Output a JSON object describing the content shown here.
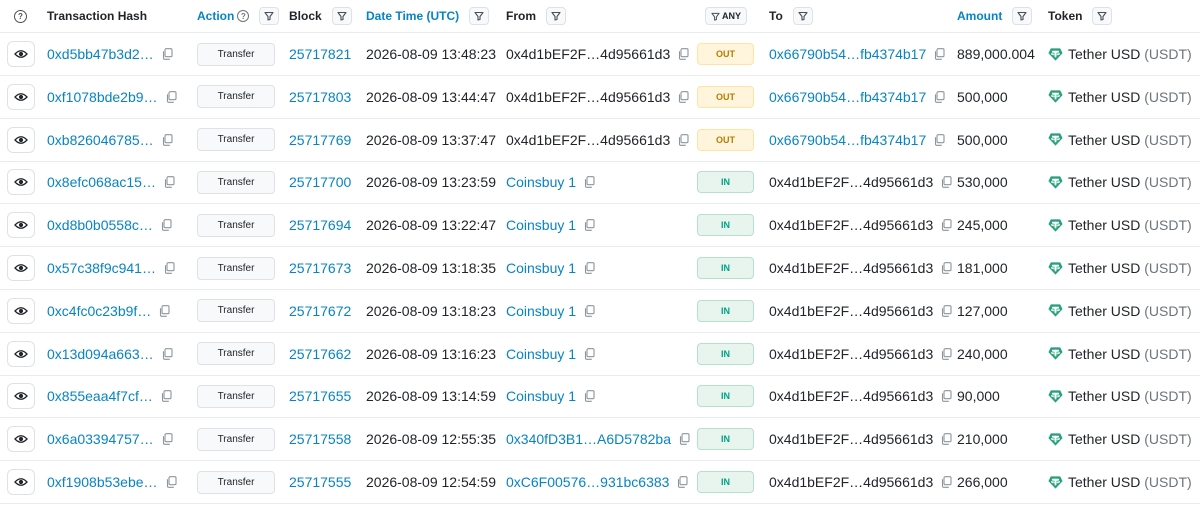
{
  "columns": {
    "help_icon": "question-circle-icon",
    "tx_hash": "Transaction Hash",
    "action": "Action",
    "block": "Block",
    "datetime": "Date Time (UTC)",
    "from": "From",
    "direction_filter": "ANY",
    "to": "To",
    "amount": "Amount",
    "token": "Token"
  },
  "colors": {
    "link": "#0784c3",
    "out_badge": "#b47d00",
    "in_badge": "#00a186",
    "tether": "#26a17b"
  },
  "rows": [
    {
      "hash": "0xd5bb47b3d2…",
      "action": "Transfer",
      "block": "25717821",
      "time": "2026-08-09 13:48:23",
      "from": "0x4d1bEF2F…4d95661d3",
      "from_link": false,
      "dir": "OUT",
      "to": "0x66790b54…fb4374b17",
      "to_link": true,
      "amount": "889,000.004",
      "token": "Tether USD",
      "symbol": "(USDT)"
    },
    {
      "hash": "0xf1078bde2b9…",
      "action": "Transfer",
      "block": "25717803",
      "time": "2026-08-09 13:44:47",
      "from": "0x4d1bEF2F…4d95661d3",
      "from_link": false,
      "dir": "OUT",
      "to": "0x66790b54…fb4374b17",
      "to_link": true,
      "amount": "500,000",
      "token": "Tether USD",
      "symbol": "(USDT)"
    },
    {
      "hash": "0xb826046785…",
      "action": "Transfer",
      "block": "25717769",
      "time": "2026-08-09 13:37:47",
      "from": "0x4d1bEF2F…4d95661d3",
      "from_link": false,
      "dir": "OUT",
      "to": "0x66790b54…fb4374b17",
      "to_link": true,
      "amount": "500,000",
      "token": "Tether USD",
      "symbol": "(USDT)"
    },
    {
      "hash": "0x8efc068ac15…",
      "action": "Transfer",
      "block": "25717700",
      "time": "2026-08-09 13:23:59",
      "from": "Coinsbuy 1",
      "from_link": true,
      "dir": "IN",
      "to": "0x4d1bEF2F…4d95661d3",
      "to_link": false,
      "amount": "530,000",
      "token": "Tether USD",
      "symbol": "(USDT)"
    },
    {
      "hash": "0xd8b0b0558c…",
      "action": "Transfer",
      "block": "25717694",
      "time": "2026-08-09 13:22:47",
      "from": "Coinsbuy 1",
      "from_link": true,
      "dir": "IN",
      "to": "0x4d1bEF2F…4d95661d3",
      "to_link": false,
      "amount": "245,000",
      "token": "Tether USD",
      "symbol": "(USDT)"
    },
    {
      "hash": "0x57c38f9c941…",
      "action": "Transfer",
      "block": "25717673",
      "time": "2026-08-09 13:18:35",
      "from": "Coinsbuy 1",
      "from_link": true,
      "dir": "IN",
      "to": "0x4d1bEF2F…4d95661d3",
      "to_link": false,
      "amount": "181,000",
      "token": "Tether USD",
      "symbol": "(USDT)"
    },
    {
      "hash": "0xc4fc0c23b9f…",
      "action": "Transfer",
      "block": "25717672",
      "time": "2026-08-09 13:18:23",
      "from": "Coinsbuy 1",
      "from_link": true,
      "dir": "IN",
      "to": "0x4d1bEF2F…4d95661d3",
      "to_link": false,
      "amount": "127,000",
      "token": "Tether USD",
      "symbol": "(USDT)"
    },
    {
      "hash": "0x13d094a663…",
      "action": "Transfer",
      "block": "25717662",
      "time": "2026-08-09 13:16:23",
      "from": "Coinsbuy 1",
      "from_link": true,
      "dir": "IN",
      "to": "0x4d1bEF2F…4d95661d3",
      "to_link": false,
      "amount": "240,000",
      "token": "Tether USD",
      "symbol": "(USDT)"
    },
    {
      "hash": "0x855eaa4f7cf…",
      "action": "Transfer",
      "block": "25717655",
      "time": "2026-08-09 13:14:59",
      "from": "Coinsbuy 1",
      "from_link": true,
      "dir": "IN",
      "to": "0x4d1bEF2F…4d95661d3",
      "to_link": false,
      "amount": "90,000",
      "token": "Tether USD",
      "symbol": "(USDT)"
    },
    {
      "hash": "0x6a03394757…",
      "action": "Transfer",
      "block": "25717558",
      "time": "2026-08-09 12:55:35",
      "from": "0x340fD3B1…A6D5782ba",
      "from_link": true,
      "dir": "IN",
      "to": "0x4d1bEF2F…4d95661d3",
      "to_link": false,
      "amount": "210,000",
      "token": "Tether USD",
      "symbol": "(USDT)"
    },
    {
      "hash": "0xf1908b53ebe…",
      "action": "Transfer",
      "block": "25717555",
      "time": "2026-08-09 12:54:59",
      "from": "0xC6F00576…931bc6383",
      "from_link": true,
      "dir": "IN",
      "to": "0x4d1bEF2F…4d95661d3",
      "to_link": false,
      "amount": "266,000",
      "token": "Tether USD",
      "symbol": "(USDT)"
    }
  ]
}
